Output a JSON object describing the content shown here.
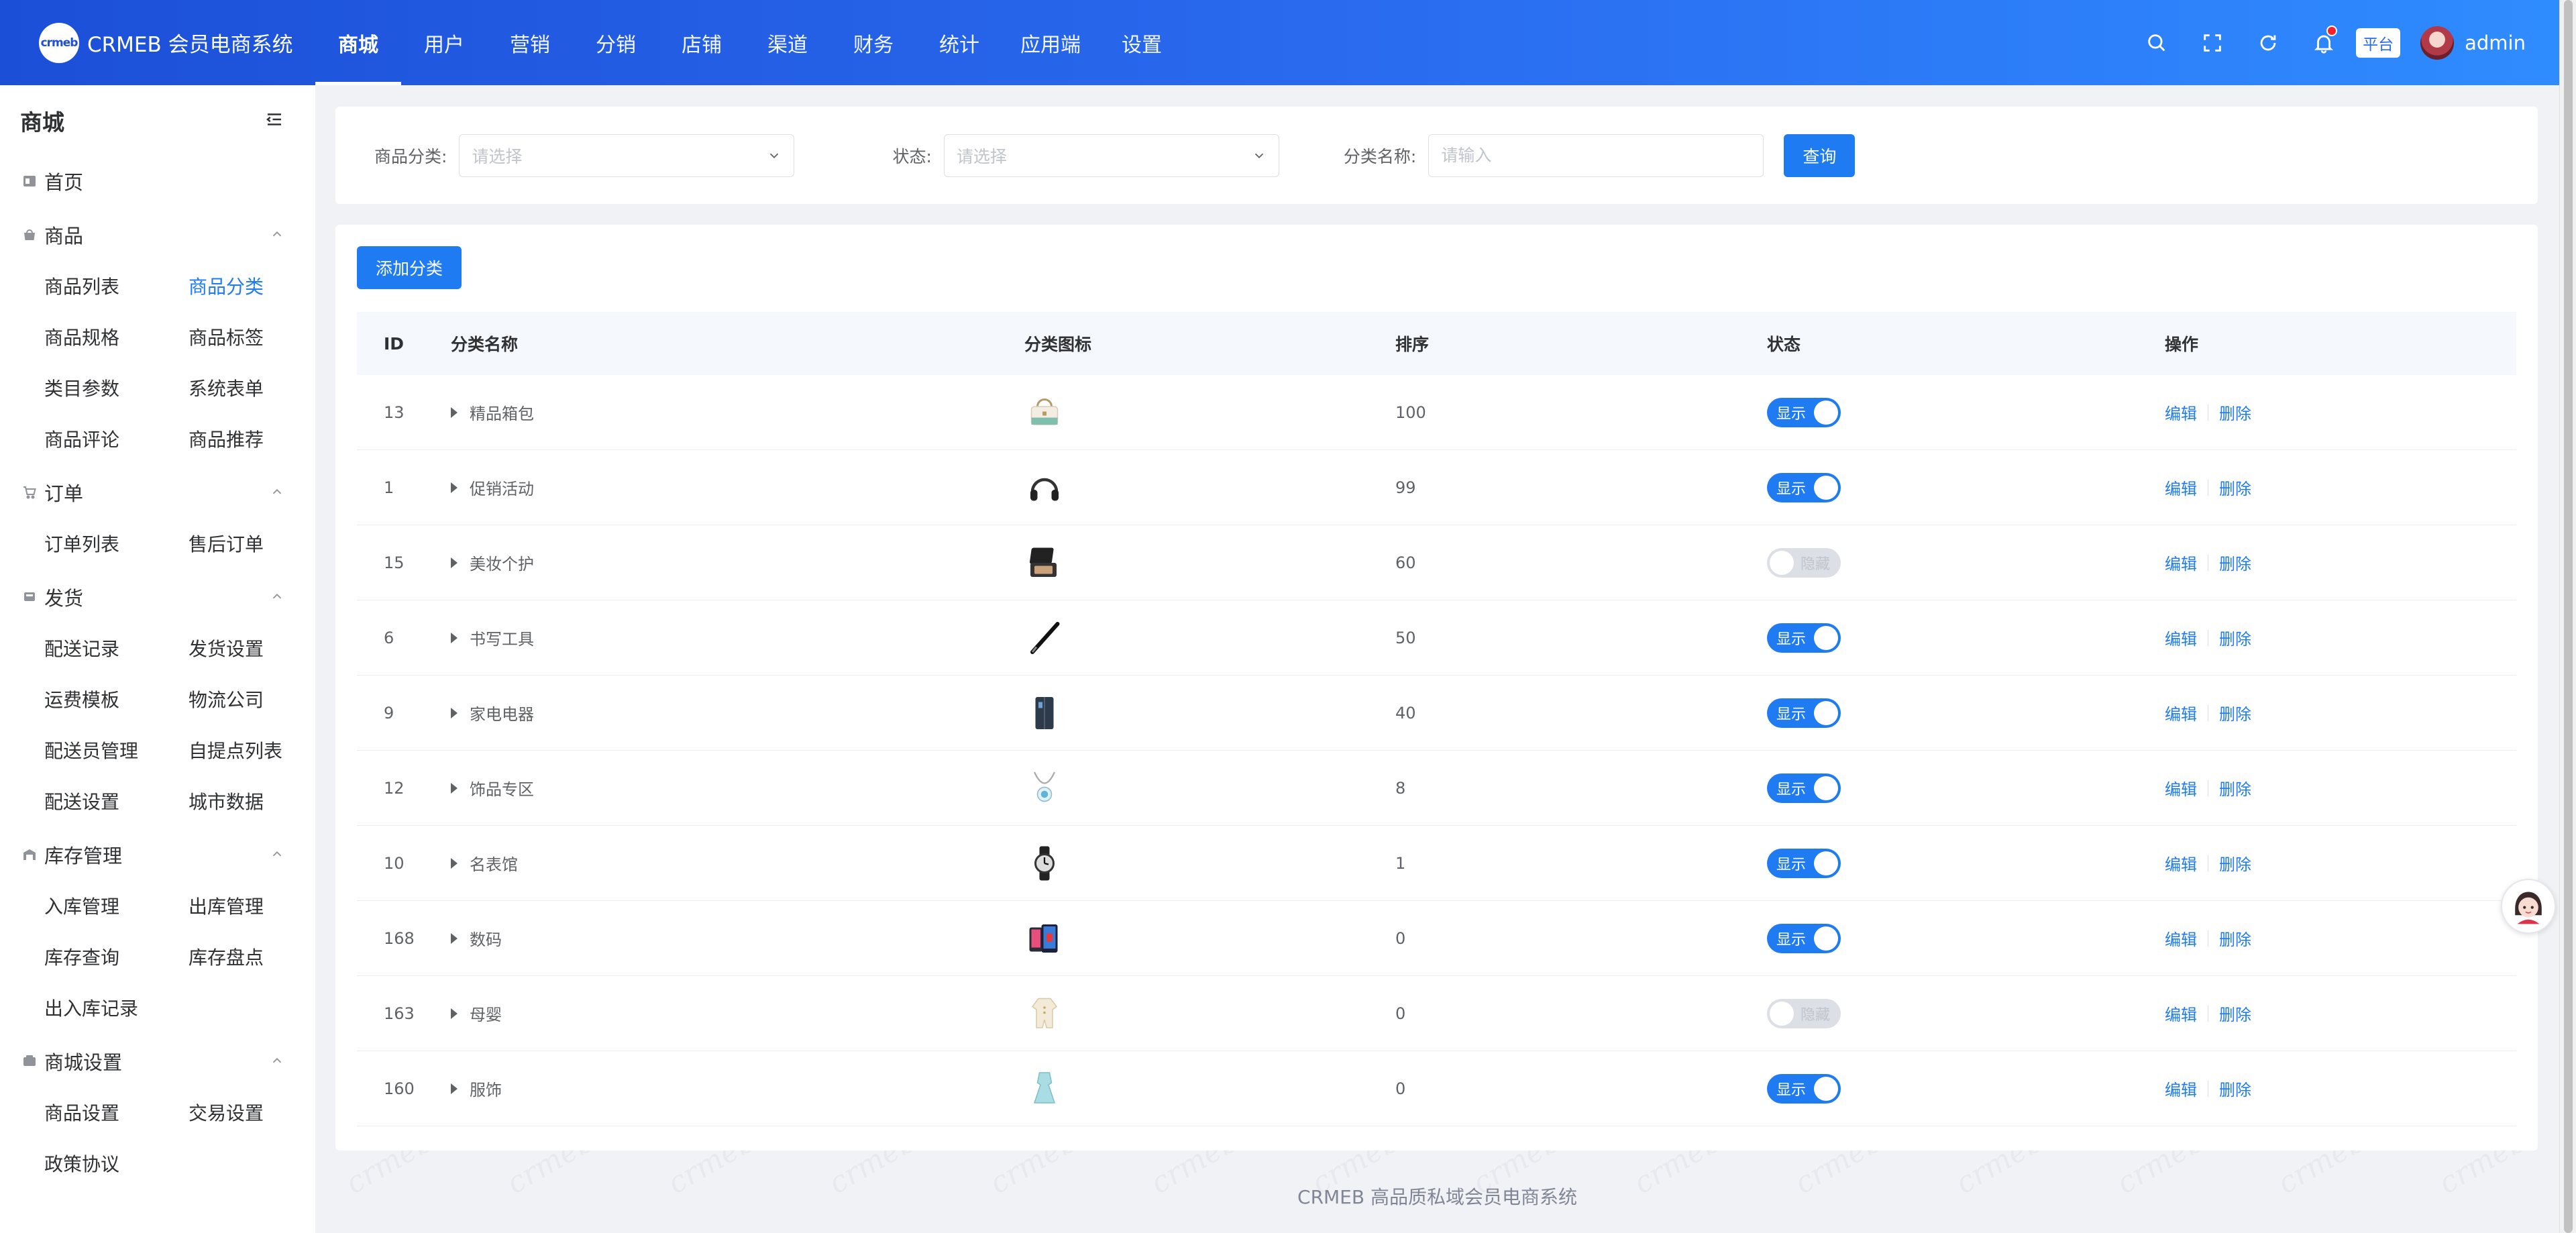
{
  "brand": {
    "logo_mark": "crmeb",
    "name": "CRMEB 会员电商系统"
  },
  "topnav": [
    {
      "label": "商城",
      "active": true
    },
    {
      "label": "用户"
    },
    {
      "label": "营销"
    },
    {
      "label": "分销"
    },
    {
      "label": "店铺"
    },
    {
      "label": "渠道"
    },
    {
      "label": "财务"
    },
    {
      "label": "统计"
    },
    {
      "label": "应用端"
    },
    {
      "label": "设置"
    }
  ],
  "topright": {
    "platform_badge": "平台",
    "username": "admin"
  },
  "sidebar": {
    "title": "商城",
    "home": "首页",
    "groups": [
      {
        "label": "商品",
        "icon": "goods-icon",
        "items": [
          "商品列表",
          "商品分类",
          "商品规格",
          "商品标签",
          "类目参数",
          "系统表单",
          "商品评论",
          "商品推荐"
        ],
        "active_index": 1
      },
      {
        "label": "订单",
        "icon": "cart-icon",
        "items": [
          "订单列表",
          "售后订单"
        ]
      },
      {
        "label": "发货",
        "icon": "truck-icon",
        "items": [
          "配送记录",
          "发货设置",
          "运费模板",
          "物流公司",
          "配送员管理",
          "自提点列表",
          "配送设置",
          "城市数据"
        ]
      },
      {
        "label": "库存管理",
        "icon": "warehouse-icon",
        "items": [
          "入库管理",
          "出库管理",
          "库存查询",
          "库存盘点",
          "出入库记录"
        ]
      },
      {
        "label": "商城设置",
        "icon": "settings-icon",
        "items": [
          "商品设置",
          "交易设置",
          "政策协议"
        ]
      }
    ]
  },
  "filters": {
    "category_label": "商品分类:",
    "category_placeholder": "请选择",
    "status_label": "状态:",
    "status_placeholder": "请选择",
    "name_label": "分类名称:",
    "name_placeholder": "请输入",
    "query_button": "查询"
  },
  "table": {
    "add_button": "添加分类",
    "headers": {
      "id": "ID",
      "name": "分类名称",
      "icon": "分类图标",
      "sort": "排序",
      "status": "状态",
      "ops": "操作"
    },
    "switch_on": "显示",
    "switch_off": "隐藏",
    "edit_label": "编辑",
    "delete_label": "删除",
    "rows": [
      {
        "id": "13",
        "name": "精品箱包",
        "icon": "handbag-icon",
        "sort": "100",
        "visible": true
      },
      {
        "id": "1",
        "name": "促销活动",
        "icon": "headphones-icon",
        "sort": "99",
        "visible": true
      },
      {
        "id": "15",
        "name": "美妆个护",
        "icon": "compact-powder-icon",
        "sort": "60",
        "visible": false
      },
      {
        "id": "6",
        "name": "书写工具",
        "icon": "pen-icon",
        "sort": "50",
        "visible": true
      },
      {
        "id": "9",
        "name": "家电电器",
        "icon": "fridge-icon",
        "sort": "40",
        "visible": true
      },
      {
        "id": "12",
        "name": "饰品专区",
        "icon": "necklace-icon",
        "sort": "8",
        "visible": true
      },
      {
        "id": "10",
        "name": "名表馆",
        "icon": "watch-icon",
        "sort": "1",
        "visible": true
      },
      {
        "id": "168",
        "name": "数码",
        "icon": "phones-icon",
        "sort": "0",
        "visible": true
      },
      {
        "id": "163",
        "name": "母婴",
        "icon": "baby-romper-icon",
        "sort": "0",
        "visible": false
      },
      {
        "id": "160",
        "name": "服饰",
        "icon": "dress-icon",
        "sort": "0",
        "visible": true
      }
    ]
  },
  "footer": "CRMEB 高品质私域会员电商系统",
  "watermark_text": "crmeb",
  "colors": {
    "primary": "#1f7bf2",
    "topbar_start": "#1c4fd8",
    "topbar_end": "#2f8cff"
  }
}
